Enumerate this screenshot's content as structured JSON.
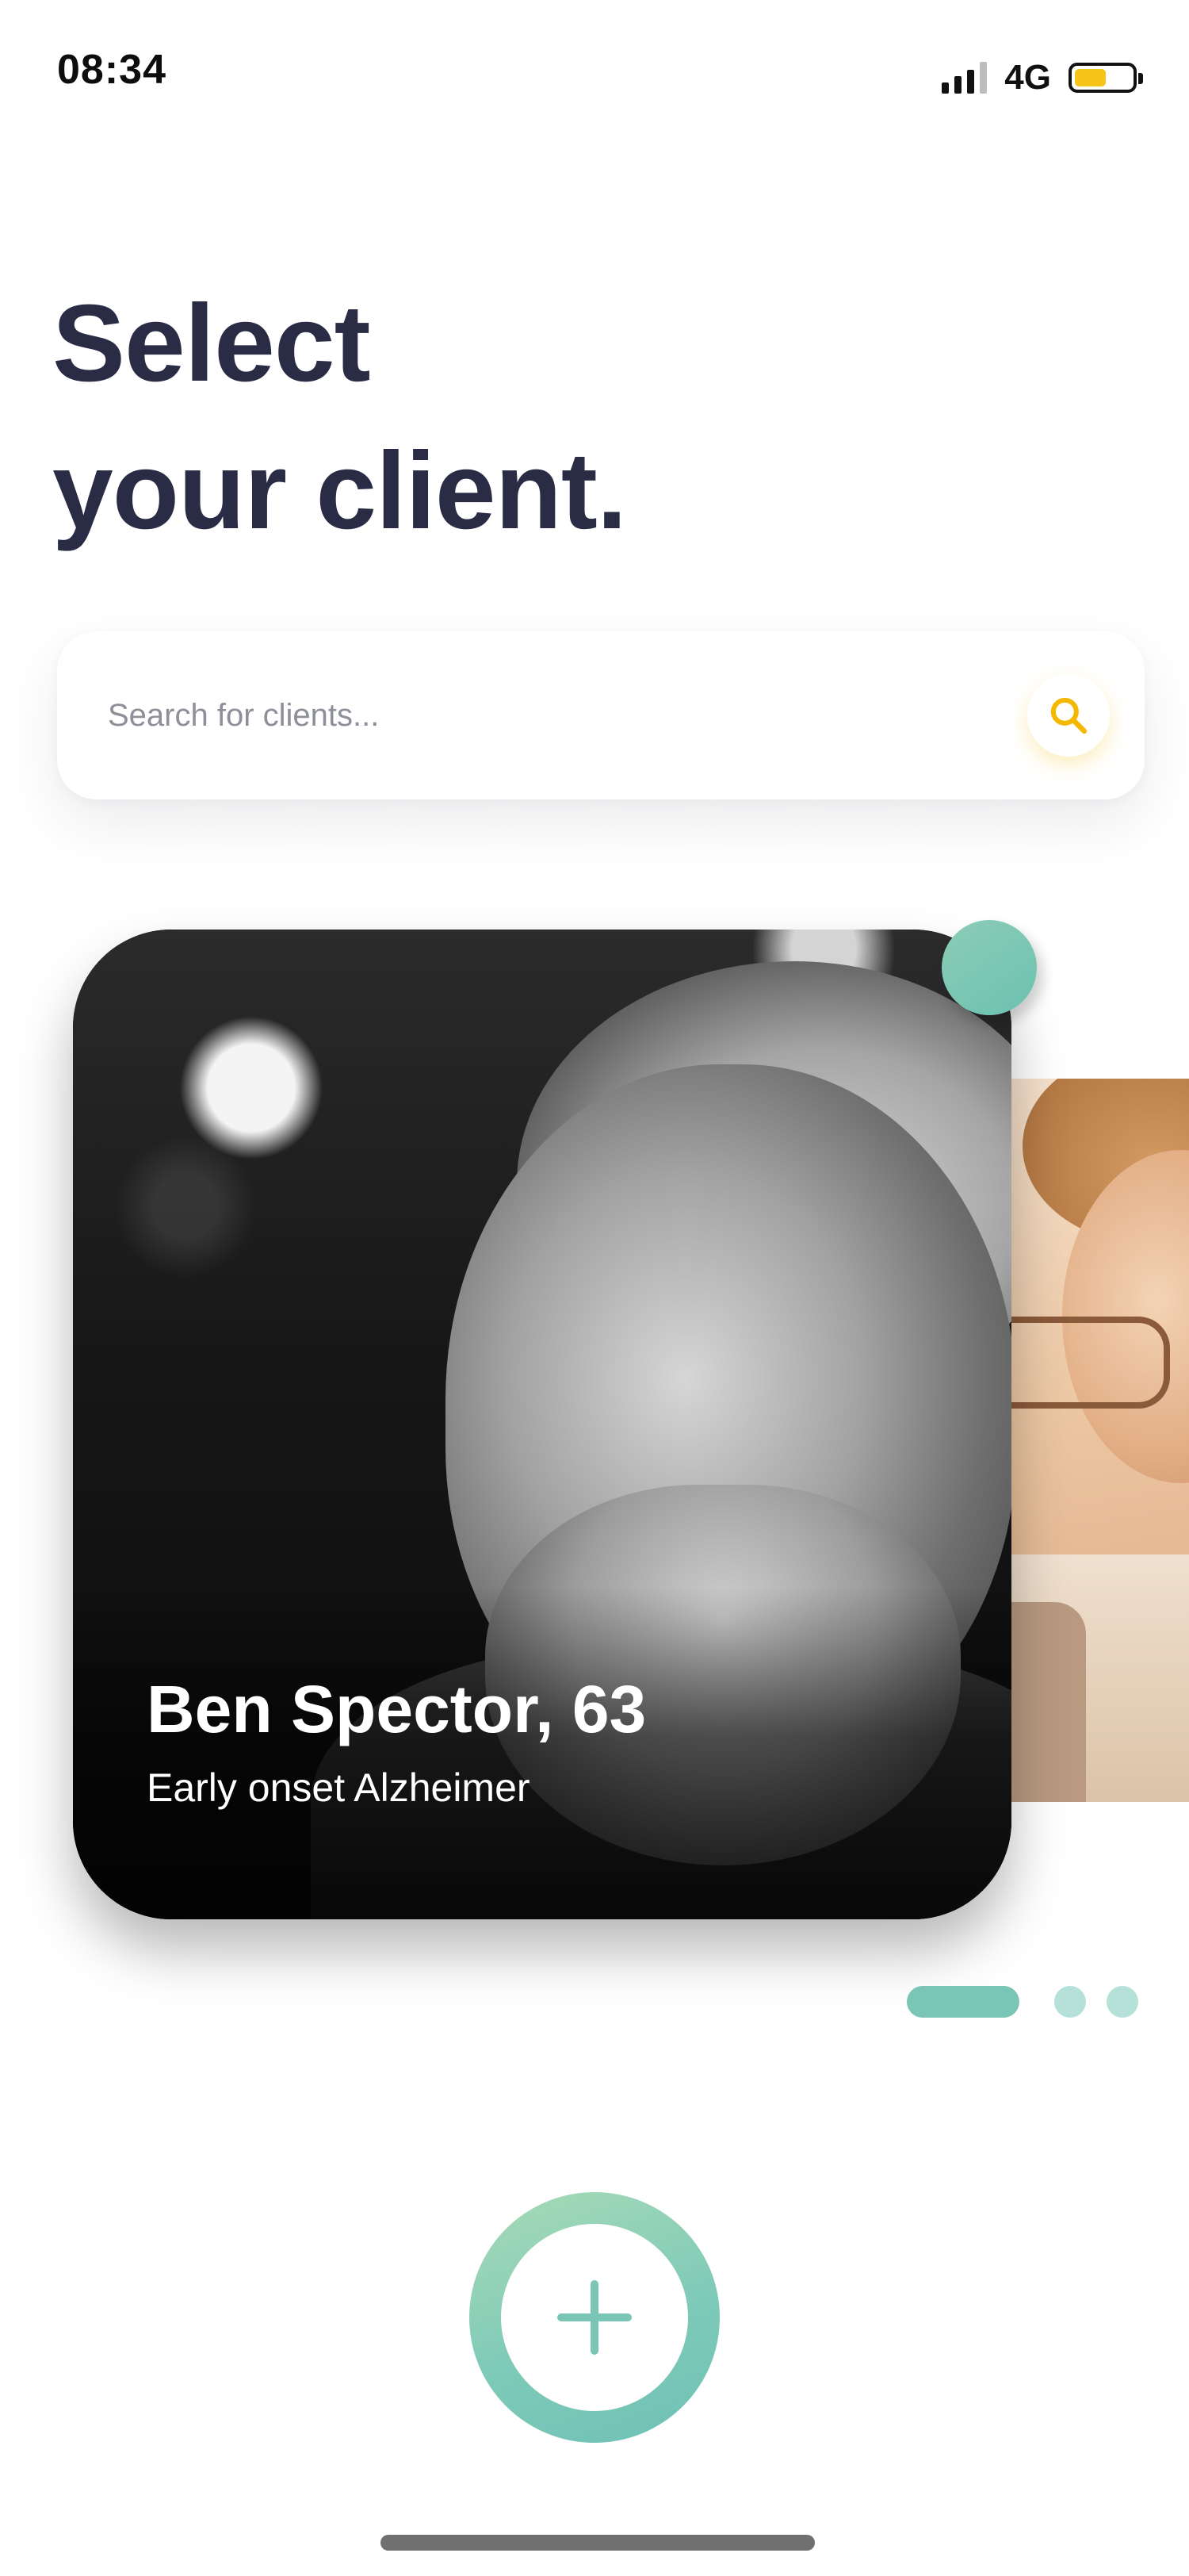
{
  "status_bar": {
    "time": "08:34",
    "network": "4G",
    "battery_level": 0.55,
    "battery_color": "#f5c518"
  },
  "header": {
    "title_line1": "Select",
    "title_line2": "your client."
  },
  "search": {
    "placeholder": "Search for clients...",
    "icon": "search-icon",
    "icon_color": "#f5b800"
  },
  "carousel": {
    "current_client": {
      "name_age": "Ben Spector, 63",
      "condition": "Early onset Alzheimer",
      "status_color": "#7ac5b5"
    },
    "page_count": 3,
    "active_page": 1
  },
  "actions": {
    "add_icon": "plus-icon",
    "accent_color": "#7ac5b5"
  }
}
